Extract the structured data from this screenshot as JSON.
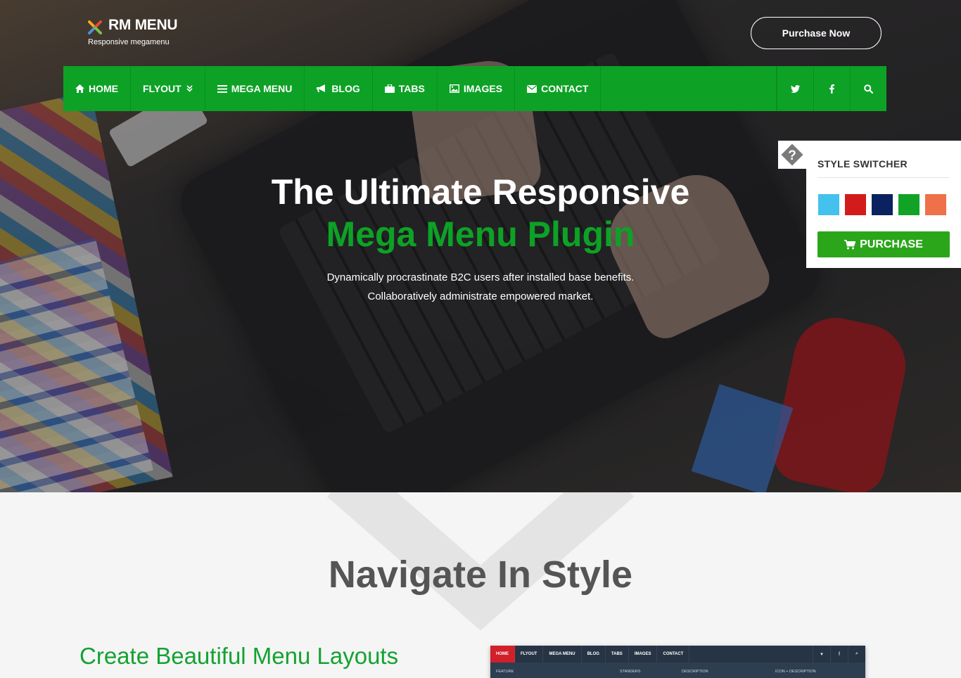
{
  "logo": {
    "title": "RM MENU",
    "subtitle": "Responsive megamenu"
  },
  "header": {
    "purchase_label": "Purchase Now"
  },
  "nav": {
    "items": [
      {
        "label": "HOME",
        "icon": "home-icon"
      },
      {
        "label": "FLYOUT",
        "icon": "chevron-down-icon"
      },
      {
        "label": "MEGA MENU",
        "icon": "list-icon"
      },
      {
        "label": "BLOG",
        "icon": "bullhorn-icon"
      },
      {
        "label": "TABS",
        "icon": "briefcase-icon"
      },
      {
        "label": "IMAGES",
        "icon": "image-icon"
      },
      {
        "label": "CONTACT",
        "icon": "envelope-icon"
      }
    ],
    "social": [
      "twitter-icon",
      "facebook-icon",
      "search-icon"
    ]
  },
  "hero": {
    "title_line1": "The Ultimate Responsive",
    "title_line2": "Mega Menu Plugin",
    "text_line1": "Dynamically procrastinate B2C users after installed base benefits.",
    "text_line2": "Collaboratively administrate empowered market."
  },
  "style_switcher": {
    "title": "STYLE SWITCHER",
    "colors": [
      "#44c1ec",
      "#d41b1b",
      "#0b2260",
      "#12a326",
      "#ef7149"
    ],
    "purchase_label": "PURCHASE"
  },
  "section": {
    "title": "Navigate In Style",
    "subtitle": "Create Beautiful Menu Layouts"
  },
  "preview": {
    "nav": [
      "HOME",
      "FLYOUT",
      "MEGA MENU",
      "BLOG",
      "TABS",
      "IMAGES",
      "CONTACT"
    ],
    "columns": [
      "FEATURE",
      "STANDERS",
      "DESCRIPTION",
      "ICON + DESCRIPTION"
    ]
  },
  "colors": {
    "accent": "#0da226",
    "purchase_green": "#2ba61a",
    "title_grey": "#555555"
  }
}
